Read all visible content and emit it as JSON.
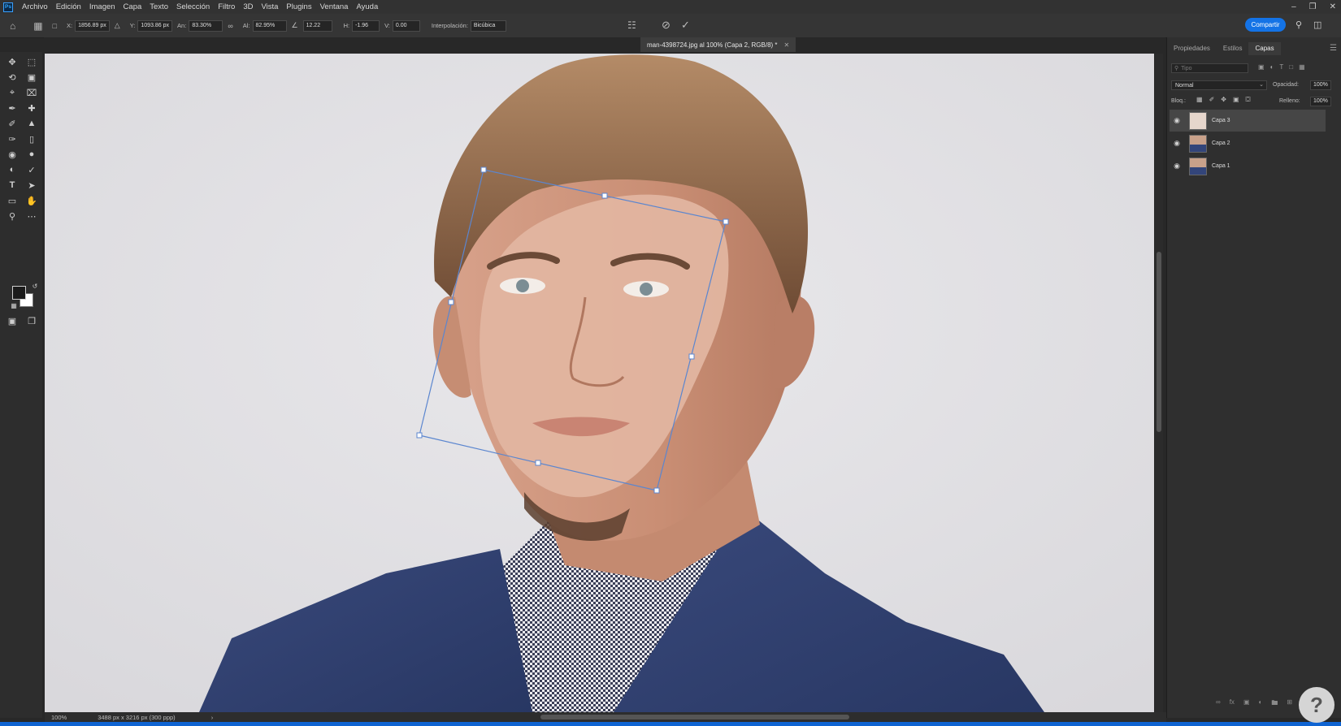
{
  "menubar": {
    "app_logo": "Ps",
    "items": [
      "Archivo",
      "Edición",
      "Imagen",
      "Capa",
      "Texto",
      "Selección",
      "Filtro",
      "3D",
      "Vista",
      "Plugins",
      "Ventana",
      "Ayuda"
    ]
  },
  "options": {
    "x_label": "X:",
    "x_value": "1856.89 px",
    "y_label": "Y:",
    "y_value": "1093.86 px",
    "w_label": "An:",
    "w_value": "83.30%",
    "h_label": "Al:",
    "h_value": "82.95%",
    "angle_value": "12.22",
    "hskew_label": "H:",
    "hskew_value": "-1.96",
    "vskew_label": "V:",
    "vskew_value": "0.00",
    "interp_label": "Interpolación:",
    "interp_value": "Bicúbica",
    "share_label": "Compartir"
  },
  "document": {
    "tab_title": "man-4398724.jpg al 100% (Capa 2, RGB/8) *",
    "zoom": "100%",
    "doc_info": "3488 px x 3216 px (300 ppp)"
  },
  "panel": {
    "tabs": [
      "Propiedades",
      "Estilos",
      "Capas"
    ],
    "active_tab": "Capas",
    "filter_placeholder": "Tipo",
    "blend_mode": "Normal",
    "opacity_label": "Opacidad:",
    "opacity_value": "100%",
    "lock_label": "Bloq.:",
    "fill_label": "Relleno:",
    "fill_value": "100%",
    "layers": [
      {
        "name": "Capa 3"
      },
      {
        "name": "Capa 2"
      },
      {
        "name": "Capa 1"
      }
    ]
  },
  "colors": {
    "accent": "#1473e6",
    "bounding_box": "#5b86cf"
  },
  "icons": {
    "cancel": "cancel-icon",
    "commit": "check-icon",
    "home": "home-icon",
    "search": "search-icon"
  },
  "watermark": {
    "label": "?"
  }
}
